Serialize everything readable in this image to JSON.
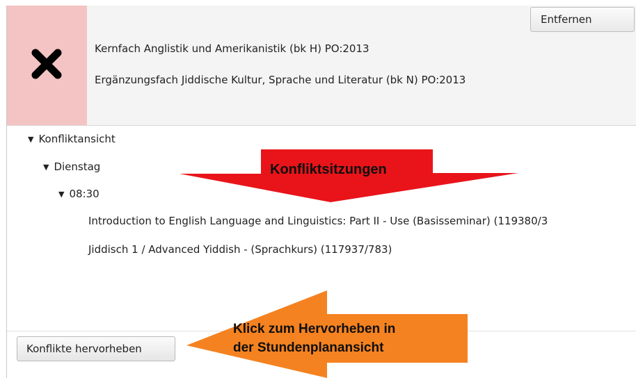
{
  "header": {
    "remove_label": "Entfernen",
    "programs": [
      "Kernfach Anglistik und Amerikanistik (bk H) PO:2013",
      "Ergänzungsfach Jiddische Kultur, Sprache und Literatur (bk N) PO:2013"
    ],
    "status_icon": "cross-icon",
    "status_color": "#f4c3c3"
  },
  "tree": {
    "root": "Konfliktansicht",
    "day": "Dienstag",
    "time": "08:30",
    "sessions": [
      "Introduction to English Language and Linguistics: Part II - Use (Basisseminar) (119380/3",
      "Jiddisch 1 / Advanced Yiddish - (Sprachkurs) (117937/783)"
    ]
  },
  "footer": {
    "highlight_label": "Konflikte hervorheben"
  },
  "annotations": {
    "sessions_callout": "Konfliktsitzungen",
    "button_callout_line1": "Klick zum Hervorheben in",
    "button_callout_line2": "der Stundenplanansicht",
    "sessions_callout_color": "#e8141a",
    "button_callout_color": "#f58220"
  }
}
